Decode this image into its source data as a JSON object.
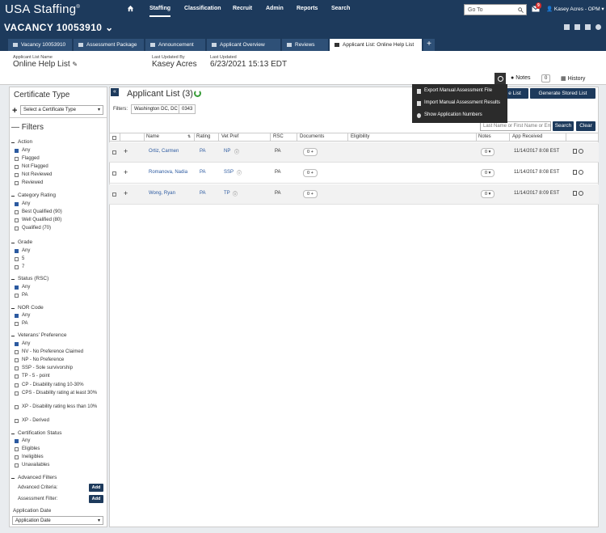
{
  "app": {
    "logo": "USA Staffing",
    "nav": [
      "Staffing",
      "Classification",
      "Recruit",
      "Admin",
      "Reports",
      "Search"
    ],
    "nav_active": "Staffing",
    "goto_placeholder": "Go To",
    "mail_count": "9",
    "user": "Kasey Acres - OPM"
  },
  "vacancy": {
    "title": "VACANCY 10053910"
  },
  "tabs": [
    "Vacancy 10053910",
    "Assessment Package",
    "Announcement",
    "Applicant Overview",
    "Reviews",
    "Applicant List: Online Help List"
  ],
  "info": {
    "name_label": "Applicant List Name",
    "name_value": "Online Help List",
    "updated_by_label": "Last Updated By",
    "updated_by_value": "Kasey Acres",
    "updated_label": "Last Updated",
    "updated_value": "6/23/2021 15:13 EDT"
  },
  "actions": {
    "notes": "Notes",
    "notes_count": "0",
    "history": "History"
  },
  "gear_menu": [
    "Export Manual Assessment File",
    "Import Manual Assessment Results",
    "Show Application Numbers"
  ],
  "sidebar": {
    "cert_type_title": "Certificate Type",
    "cert_select": "Select a Certificate Type",
    "filters_title": "Filters",
    "action_title": "Action",
    "action": [
      "Any",
      "Flagged",
      "Not Flagged",
      "Not Reviewed",
      "Reviewed"
    ],
    "category_title": "Category Rating",
    "category": [
      "Any",
      "Best Qualified (90)",
      "Well Qualified (80)",
      "Qualified (70)"
    ],
    "grade_title": "Grade",
    "grade": [
      "Any",
      "5",
      "7"
    ],
    "status_title": "Status (RSC)",
    "status": [
      "Any",
      "PA"
    ],
    "nor_title": "NOR Code",
    "nor": [
      "Any",
      "PA"
    ],
    "vet_title": "Veterans' Preference",
    "vet": [
      "Any",
      "NV - No Preference Claimed",
      "NP - No Preference",
      "SSP - Sole survivorship",
      "TP - 5 - point",
      "CP - Disability rating 10-30%",
      "CPS - Disability rating at least 30%",
      "XP - Disability rating less than 10%",
      "XP - Derived"
    ],
    "cert_status_title": "Certification Status",
    "cert_status": [
      "Any",
      "Eligibles",
      "Ineligibles",
      "Unavailables"
    ],
    "advanced_title": "Advanced Filters",
    "advanced_criteria": "Advanced Criteria:",
    "assessment_filter": "Assessment Filter:",
    "add": "Add",
    "app_date_title": "Application Date",
    "app_date_select": "Application Date"
  },
  "main": {
    "title": "Applicant List (3)",
    "btn_list": "e List",
    "btn_stored": "Generate Stored List",
    "filters_label": "Filters:",
    "chips": [
      "Washington DC, DC",
      "0343"
    ],
    "search_placeholder": "Last Name or First Name or Em",
    "search_btn": "Search",
    "clear_btn": "Clear",
    "columns": [
      "Name",
      "Rating",
      "Vet Pref",
      "RSC",
      "Documents",
      "Eligibility",
      "Notes",
      "App Received"
    ],
    "rows": [
      {
        "name": "Ortiz, Carmen",
        "rating": "PA",
        "vet": "NP",
        "rsc": "PA",
        "docs": "0",
        "notes": "0",
        "received": "11/14/2017 8:08 EST"
      },
      {
        "name": "Romanova, Nadia",
        "rating": "PA",
        "vet": "SSP",
        "rsc": "PA",
        "docs": "0",
        "notes": "0",
        "received": "11/14/2017 8:08 EST"
      },
      {
        "name": "Wong, Ryan",
        "rating": "PA",
        "vet": "TP",
        "rsc": "PA",
        "docs": "0",
        "notes": "0",
        "received": "11/14/2017 8:09 EST"
      }
    ]
  }
}
